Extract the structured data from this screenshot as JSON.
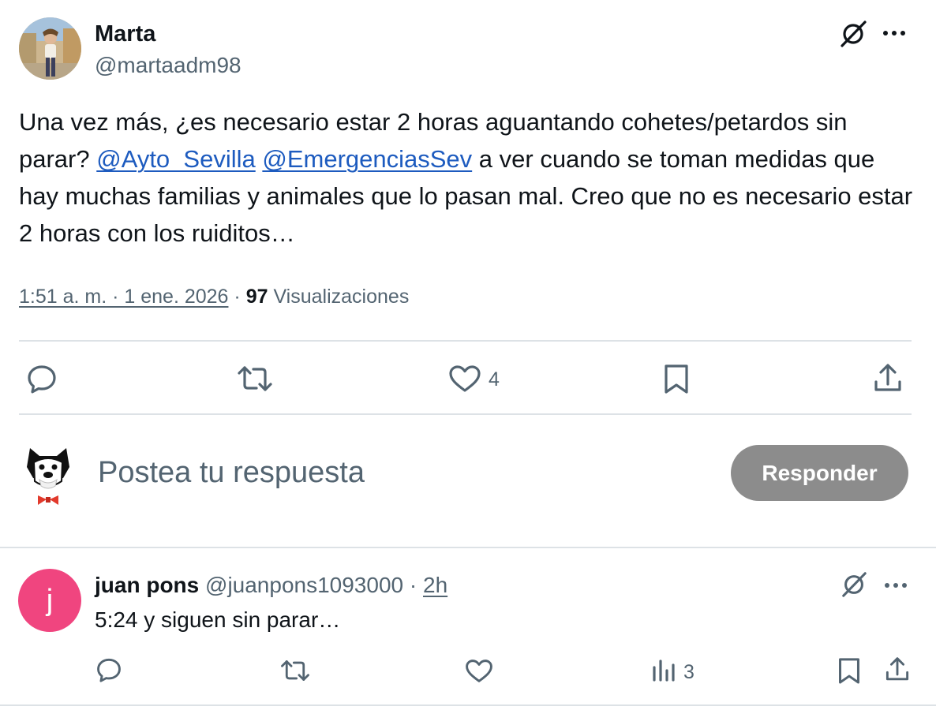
{
  "post": {
    "author_name": "Marta",
    "author_handle": "@martaadm98",
    "text_1": "Una vez más, ¿es necesario estar 2 horas aguantando cohetes/petardos sin parar? ",
    "mention_1": "@Ayto_Sevilla",
    "text_2": " ",
    "mention_2": "@EmergenciasSev",
    "text_3": " a ver cuando se toman medidas que hay muchas familias y animales que lo pasan mal. Creo que no es necesario estar 2 horas con los ruiditos…",
    "timestamp": "1:51 a. m. · 1 ene. 2026",
    "separator": " · ",
    "views_count": "97",
    "views_label": "Visualizaciones",
    "likes_count": "4"
  },
  "composer": {
    "placeholder": "Postea tu respuesta",
    "button_label": "Responder"
  },
  "reply": {
    "avatar_letter": "j",
    "author_name": "juan pons",
    "author_handle": "@juanpons1093000",
    "separator": " · ",
    "time": "2h",
    "text": "5:24 y siguen sin parar…",
    "views_count": "3"
  },
  "icons": [
    "grok-icon",
    "more-icon",
    "reply-icon",
    "retweet-icon",
    "like-icon",
    "views-icon",
    "bookmark-icon",
    "share-icon"
  ],
  "colors": {
    "mention": "#1d5bbf",
    "secondary_text": "#536471",
    "reply_button": "#8c8c8c",
    "reply_avatar": "#f0457f",
    "divider": "#dde2e6"
  }
}
